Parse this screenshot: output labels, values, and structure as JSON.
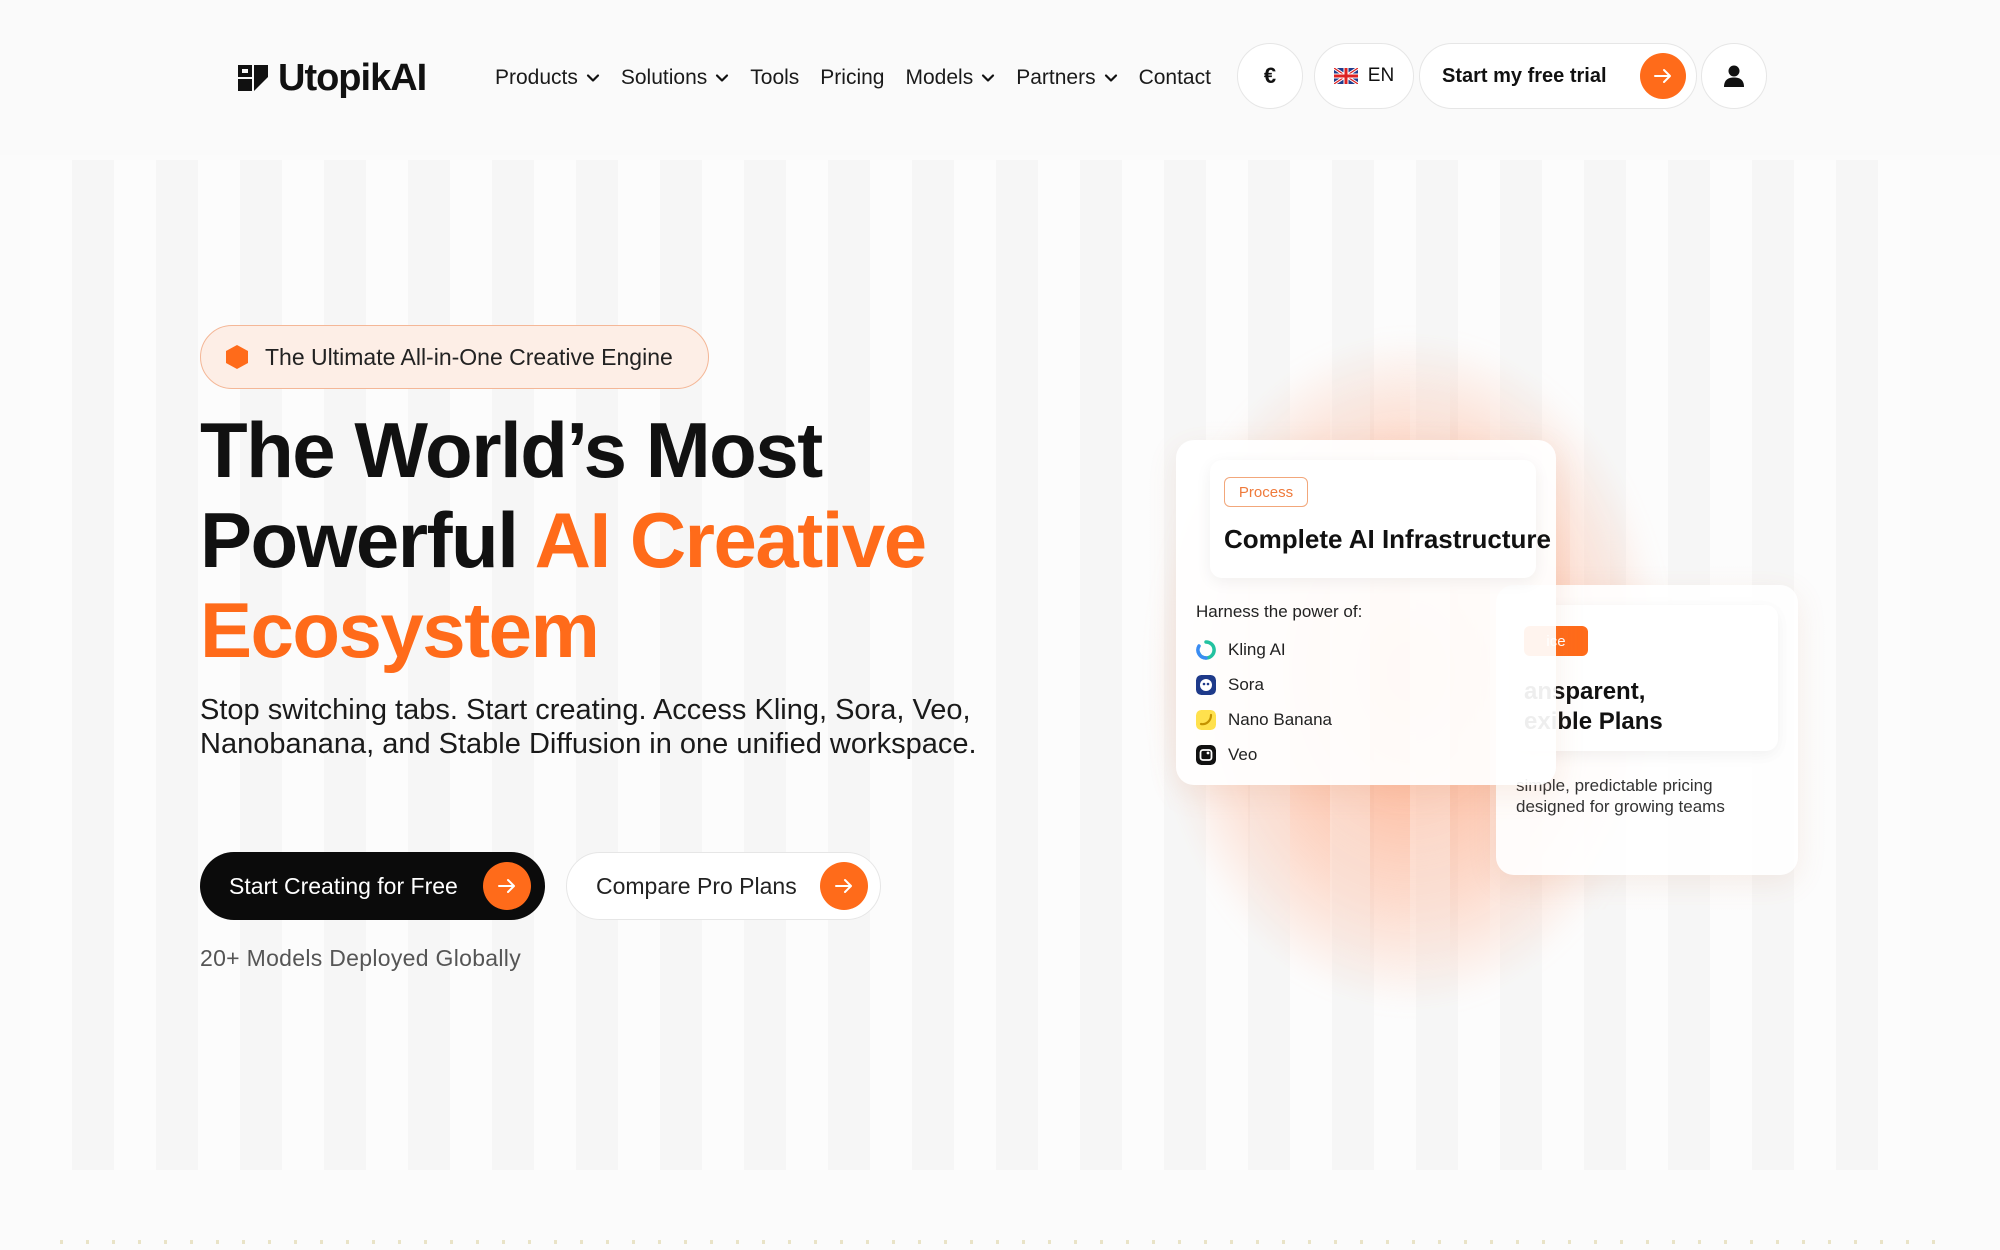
{
  "nav": {
    "logo_text": "UtopikAI",
    "links": [
      {
        "label": "Products",
        "has_dropdown": true
      },
      {
        "label": "Solutions",
        "has_dropdown": true
      },
      {
        "label": "Tools",
        "has_dropdown": false
      },
      {
        "label": "Pricing",
        "has_dropdown": false
      },
      {
        "label": "Models",
        "has_dropdown": true
      },
      {
        "label": "Partners",
        "has_dropdown": true
      },
      {
        "label": "Contact",
        "has_dropdown": false
      }
    ],
    "currency_symbol": "€",
    "language": "EN",
    "trial_label": "Start my free trial",
    "user_icon": "user-icon"
  },
  "hero": {
    "badge": "The Ultimate All-in-One Creative Engine",
    "headline_part1": "The World’s Most",
    "headline_part2": "Powerful ",
    "headline_accent": "AI Creative Ecosystem",
    "subtext": "Stop switching tabs. Start creating. Access Kling, Sora, Veo, Nanobanana, and Stable Diffusion in one unified workspace.",
    "cta_primary": "Start Creating for Free",
    "cta_secondary": "Compare Pro Plans",
    "deployed": "20+ Models Deployed Globally"
  },
  "cards": {
    "infrastructure": {
      "tag": "Process",
      "title": "Complete AI Infrastructure",
      "harness": "Harness the power of:",
      "models": [
        {
          "name": "Kling AI",
          "icon": "kling-icon"
        },
        {
          "name": "Sora",
          "icon": "sora-icon"
        },
        {
          "name": "Nano Banana",
          "icon": "banana-icon"
        },
        {
          "name": "Veo",
          "icon": "veo-icon"
        }
      ]
    },
    "pricing": {
      "tag": "ice",
      "title_line1": "ansparent,",
      "title_line2": "exible Plans",
      "description": "simple, predictable pricing designed for growing teams"
    }
  },
  "colors": {
    "accent": "#ff6b1a",
    "dark": "#0b0b0b",
    "badge_bg": "#fdeee6",
    "badge_border": "#f4b797"
  }
}
